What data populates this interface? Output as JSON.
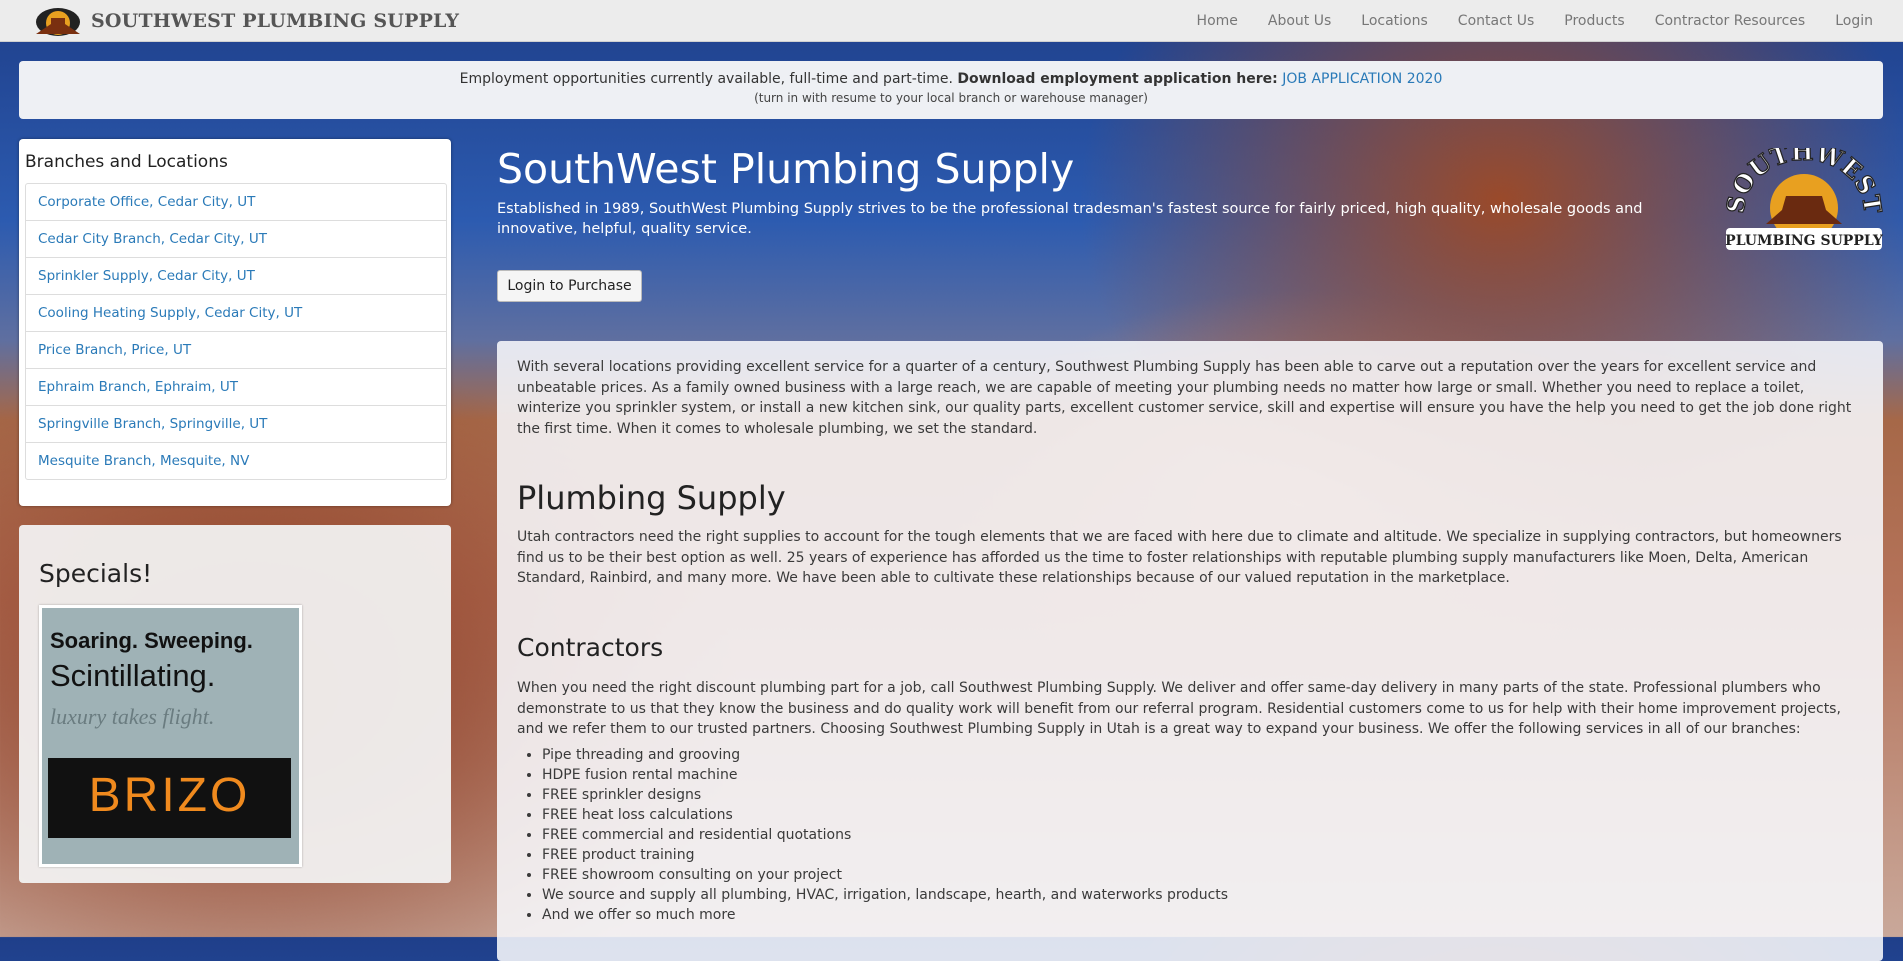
{
  "nav": {
    "brand": "SOUTHWEST PLUMBING SUPPLY",
    "items": [
      "Home",
      "About Us",
      "Locations",
      "Contact Us",
      "Products",
      "Contractor Resources",
      "Login"
    ]
  },
  "banner": {
    "text": "Employment opportunities currently available, full-time and part-time.",
    "bold": "Download employment application here:",
    "link": "JOB APPLICATION 2020",
    "note": "(turn in with resume to your local branch or warehouse manager)"
  },
  "sidebar": {
    "title": "Branches and Locations",
    "branches": [
      "Corporate Office, Cedar City, UT",
      "Cedar City Branch, Cedar City, UT",
      "Sprinkler Supply, Cedar City, UT",
      "Cooling Heating Supply, Cedar City, UT",
      "Price Branch, Price, UT",
      "Ephraim Branch, Ephraim, UT",
      "Springville Branch, Springville, UT",
      "Mesquite Branch, Mesquite, NV"
    ]
  },
  "specials": {
    "title": "Specials!",
    "ad": {
      "line1": "Soaring. Sweeping.",
      "line2": "Scintillating.",
      "line3": "luxury takes flight.",
      "brand": "BRIZO"
    }
  },
  "hero": {
    "title": "SouthWest Plumbing Supply",
    "text": "Established in 1989, SouthWest Plumbing Supply strives to be the professional tradesman's fastest source for fairly priced, high quality, wholesale goods and innovative, helpful, quality service.",
    "button": "Login to Purchase",
    "logo_top": "SOUTHWEST",
    "logo_bottom": "PLUMBING SUPPLY"
  },
  "content": {
    "intro": "With several locations providing excellent service for a quarter of a century, Southwest Plumbing Supply has been able to carve out a reputation over the years for excellent service and unbeatable prices. As a family owned business with a large reach, we are capable of meeting your plumbing needs no matter how large or small. Whether you need to replace a toilet, winterize you sprinkler system, or install a new kitchen sink, our quality parts, excellent customer service, skill and expertise will ensure you have the help you need to get the job done right the first time. When it comes to wholesale plumbing, we set the standard.",
    "plumbing_heading": "Plumbing Supply",
    "plumbing_text": "Utah contractors need the right supplies to account for the tough elements that we are faced with here due to climate and altitude. We specialize in supplying contractors, but homeowners find us to be their best option as well. 25 years of experience has afforded us the time to foster relationships with reputable plumbing supply manufacturers like Moen, Delta, American Standard, Rainbird, and many more. We have been able to cultivate these relationships because of our valued reputation in the marketplace.",
    "contractors_heading": "Contractors",
    "contractors_text": "When you need the right discount plumbing part for a job, call Southwest Plumbing Supply. We deliver and offer same-day delivery in many parts of the state. Professional plumbers who demonstrate to us that they know the business and do quality work will benefit from our referral program. Residential customers come to us for help with their home improvement projects, and we refer them to our trusted partners. Choosing Southwest Plumbing Supply in Utah is a great way to expand your business. We offer the following services in all of our branches:",
    "services": [
      "Pipe threading and grooving",
      "HDPE fusion rental machine",
      "FREE sprinkler designs",
      "FREE heat loss calculations",
      "FREE commercial and residential quotations",
      "FREE product training",
      "FREE showroom consulting on your project",
      "We source and supply all plumbing, HVAC, irrigation, landscape, hearth, and waterworks products",
      "And we offer so much more"
    ]
  }
}
